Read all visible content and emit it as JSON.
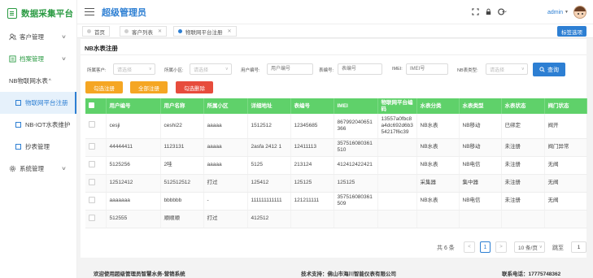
{
  "sidebar": {
    "brand": "数据采集平台",
    "items": [
      {
        "label": "客户管理",
        "icon": "users-icon"
      },
      {
        "label": "档案管理",
        "icon": "archive-icon"
      },
      {
        "label": "NB物联网水表"
      },
      {
        "label": "物联网平台注册"
      },
      {
        "label": "NB-IOT水表维护"
      },
      {
        "label": "抄表管理"
      },
      {
        "label": "系统管理",
        "icon": "gear-icon"
      }
    ]
  },
  "header": {
    "title": "超级管理员",
    "user": "admin"
  },
  "tabs": {
    "items": [
      {
        "label": "首页"
      },
      {
        "label": "客户列表"
      },
      {
        "label": "物联网平台注册"
      }
    ],
    "tab_options": "标签选项"
  },
  "panel": {
    "title": "NB水表注册"
  },
  "filters": {
    "customer_label": "所属客户:",
    "customer_placeholder": "请选择",
    "area_label": "所属小区:",
    "area_placeholder": "请选择",
    "user_no_label": "用户编号:",
    "user_no_placeholder": "用户编号",
    "meter_no_label": "表编号:",
    "meter_no_placeholder": "表编号",
    "imei_label": "IMEI:",
    "imei_placeholder": "IMEI号",
    "nb_type_label": "NB表类型:",
    "nb_type_placeholder": "请选择",
    "query": "查询"
  },
  "actions": {
    "selected_register": "勾选注册",
    "register_all": "全部注册",
    "selected_delete": "勾选删除"
  },
  "table": {
    "headers": [
      "用户编号",
      "用户名称",
      "所属小区",
      "详细地址",
      "表编号",
      "IMEI",
      "物联网平台编码",
      "水表分类",
      "水表类型",
      "水表状态",
      "阀门状态"
    ],
    "rows": [
      [
        "cesji",
        "ceshi22",
        "aaaaa",
        "1512512",
        "12345685",
        "867992040651366",
        "13557a0fbc8a4dc692d6b354217f6c39",
        "NB水表",
        "NB移动",
        "已绑定",
        "阀开"
      ],
      [
        "44444411",
        "1123131",
        "aaaaa",
        "2asfa 2412 1",
        "12411113",
        "357516080361510",
        "",
        "NB水表",
        "NB移动",
        "未注册",
        "阀门异常"
      ],
      [
        "5125256",
        "2哇",
        "aaaaa",
        "5125",
        "213124",
        "412412422421",
        "",
        "NB水表",
        "NB电信",
        "未注册",
        "无阀"
      ],
      [
        "12512412",
        "512512512",
        "打过",
        "125412",
        "125125",
        "125125",
        "",
        "采集器",
        "集中器",
        "未注册",
        "无阀"
      ],
      [
        "aaaaaaa",
        "bbbbbb",
        "-",
        "111111111111",
        "121211111",
        "357516080361509",
        "",
        "NB水表",
        "NB电信",
        "未注册",
        "无阀"
      ],
      [
        "512555",
        "顺顺顺",
        "打过",
        "412512",
        "",
        "",
        "",
        "",
        "",
        "",
        ""
      ]
    ]
  },
  "pagination": {
    "total": "共 6 条",
    "prev": "<",
    "page": "1",
    "next": ">",
    "page_size": "10 条/页",
    "jump_label": "跳至",
    "jump_value": "1"
  },
  "footer": {
    "welcome": "欢迎使用超级管理员智慧水务-营销系统",
    "support": "技术支持：佛山市海川智能仪表有限公司",
    "phone": "联系电话：17775748362"
  },
  "colors": {
    "primary": "#2d7fd3",
    "brand_green": "#2b9b43",
    "table_header": "#5fd16a",
    "orange": "#f5a623",
    "red": "#e74c3c"
  }
}
